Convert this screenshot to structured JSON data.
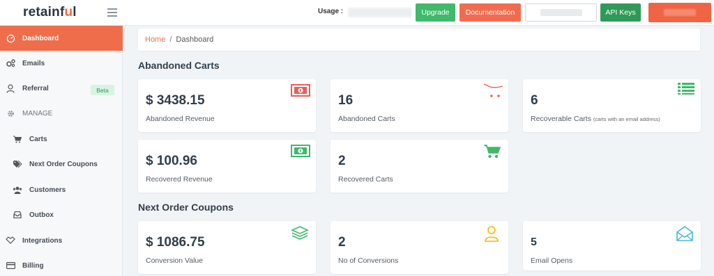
{
  "header": {
    "logo_pre": "retainf",
    "logo_u": "u",
    "logo_post": "l",
    "usage_label": "Usage :",
    "buttons": {
      "upgrade": "Upgrade",
      "documentation": "Documentation",
      "api_keys": "API Keys"
    }
  },
  "sidebar": {
    "dashboard": "Dashboard",
    "emails": "Emails",
    "referral": "Referral",
    "beta": "Beta",
    "manage": "MANAGE",
    "carts": "Carts",
    "next_order_coupons": "Next Order Coupons",
    "customers": "Customers",
    "outbox": "Outbox",
    "integrations": "Integrations",
    "billing": "Billing"
  },
  "breadcrumb": {
    "home": "Home",
    "separator": "/",
    "current": "Dashboard"
  },
  "abandoned": {
    "title": "Abandoned Carts",
    "abandoned_revenue": {
      "value": "$ 3438.15",
      "label": "Abandoned Revenue"
    },
    "abandoned_carts": {
      "value": "16",
      "label": "Abandoned Carts"
    },
    "recoverable_carts": {
      "value": "6",
      "label": "Recoverable Carts",
      "note": "(carts with an email address)"
    },
    "recovered_revenue": {
      "value": "$ 100.96",
      "label": "Recovered Revenue"
    },
    "recovered_carts": {
      "value": "2",
      "label": "Recovered Carts"
    }
  },
  "coupons": {
    "title": "Next Order Coupons",
    "conversion_value": {
      "value": "$ 1086.75",
      "label": "Conversion Value"
    },
    "conversions": {
      "value": "2",
      "label": "No of Conversions"
    },
    "email_opens": {
      "value": "5",
      "label": "Email Opens"
    }
  },
  "colors": {
    "accent": "#f06d4c",
    "green": "#3fb96a",
    "red_icon": "#ef5a5a",
    "yellow_icon": "#f5b800",
    "blue_icon": "#4bb7d8"
  }
}
